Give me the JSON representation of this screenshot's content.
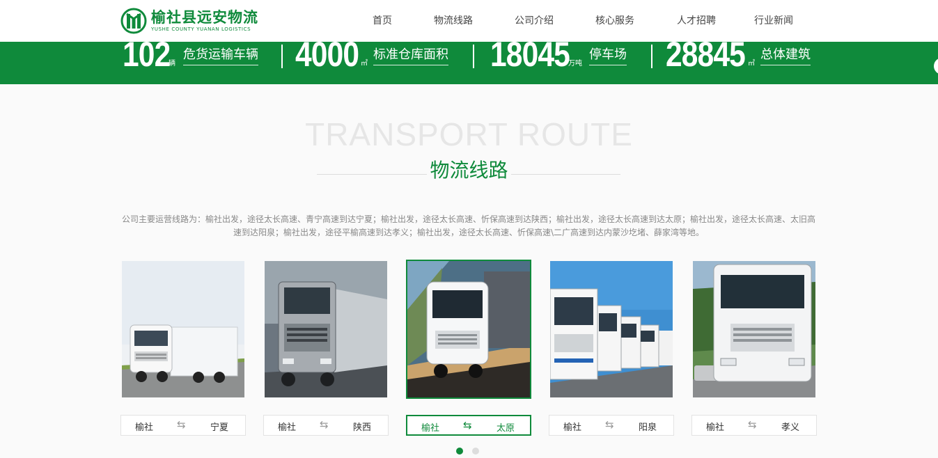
{
  "header": {
    "logo": {
      "name_cn": "榆社县远安物流",
      "name_en": "YUSHE COUNTY YUANAN LOGISTICS"
    },
    "nav": [
      {
        "label": "首页"
      },
      {
        "label": "物流线路"
      },
      {
        "label": "公司介绍"
      },
      {
        "label": "核心服务"
      },
      {
        "label": "人才招聘"
      },
      {
        "label": "行业新闻"
      }
    ]
  },
  "stats": [
    {
      "number": "102",
      "unit": "辆",
      "label": "危货运输车辆"
    },
    {
      "number": "4000",
      "unit": "㎡",
      "label": "标准仓库面积"
    },
    {
      "number": "18045",
      "unit": "万吨",
      "label": "停车场"
    },
    {
      "number": "28845",
      "unit": "㎡",
      "label": "总体建筑"
    }
  ],
  "section": {
    "title_en": "TRANSPORT ROUTE",
    "title_cn": "物流线路",
    "description": "公司主要运营线路为：榆社出发，途径太长高速、青宁高速到达宁夏；榆社出发，途径太长高速、忻保高速到达陕西；榆社出发，途径太长高速到达太原；榆社出发，途径太长高速、太旧高速到达阳泉；榆社出发，途径平榆高速到达孝义；榆社出发，途径太长高速、忻保高速\\二广高速到达内蒙沙圪堵、薛家湾等地。"
  },
  "routes": [
    {
      "from": "榆社",
      "arrow": "⇆",
      "to": "宁夏",
      "active": false
    },
    {
      "from": "榆社",
      "arrow": "⇆",
      "to": "陕西",
      "active": false
    },
    {
      "from": "榆社",
      "arrow": "⇆",
      "to": "太原",
      "active": true
    },
    {
      "from": "榆社",
      "arrow": "⇆",
      "to": "阳泉",
      "active": false
    },
    {
      "from": "榆社",
      "arrow": "⇆",
      "to": "孝义",
      "active": false
    }
  ],
  "carousel": {
    "pages": 2,
    "current": 1
  },
  "colors": {
    "brand": "#0f8a3b",
    "dot_inactive": "#dddddd",
    "text_gray": "#888888"
  },
  "icons": [
    "logo-mark-icon",
    "bidirectional-arrow-icon"
  ]
}
